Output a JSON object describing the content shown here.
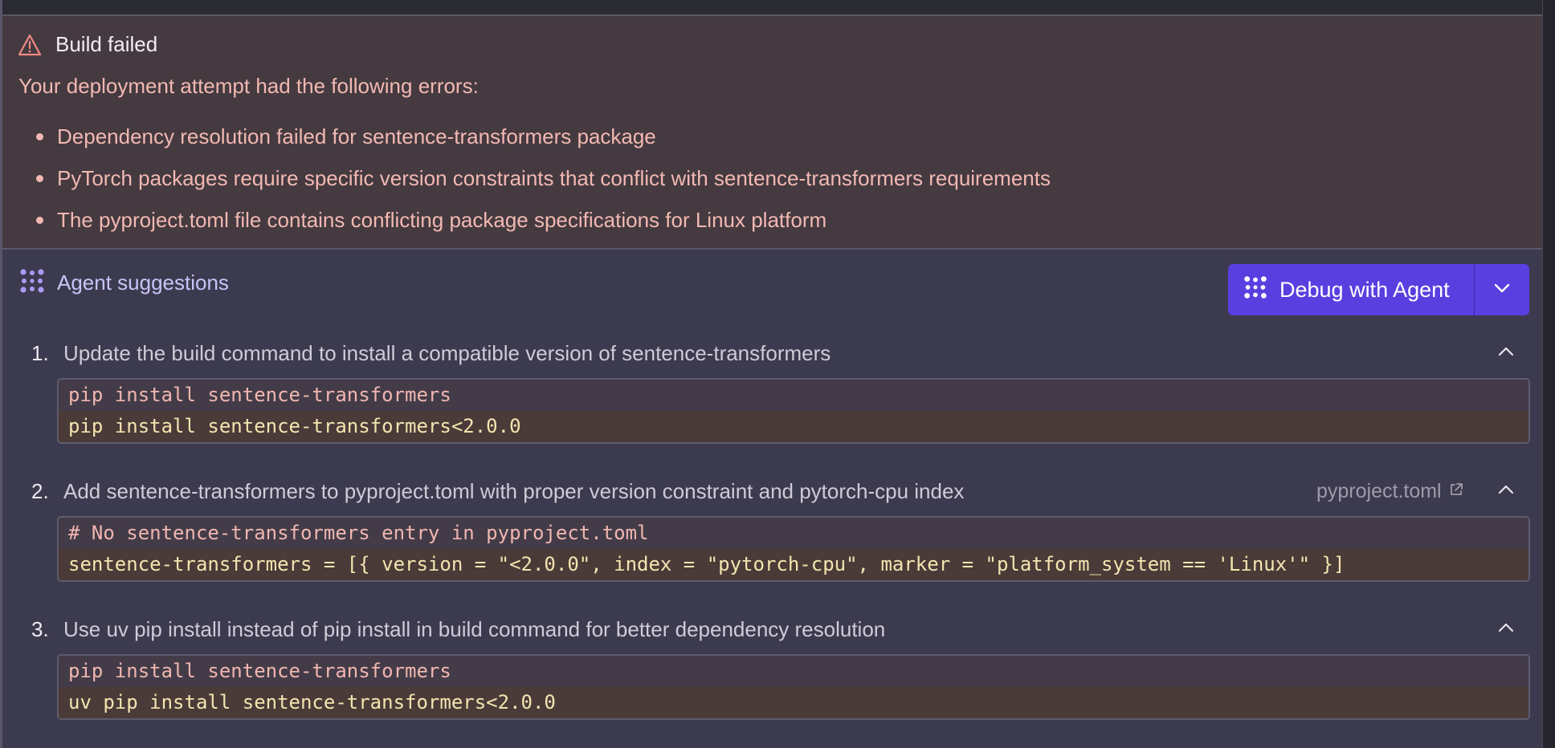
{
  "error": {
    "title": "Build failed",
    "intro": "Your deployment attempt had the following errors:",
    "items": [
      "Dependency resolution failed for sentence-transformers package",
      "PyTorch packages require specific version constraints that conflict with sentence-transformers requirements",
      "The pyproject.toml file contains conflicting package specifications for Linux platform"
    ],
    "icon": "warning-triangle-icon",
    "color": "#f3b8b2"
  },
  "suggestions": {
    "label": "Agent suggestions",
    "icon": "agent-icon",
    "debug_button": {
      "label": "Debug with Agent",
      "color": "#5a3fe0"
    },
    "steps": [
      {
        "number": "1.",
        "text": "Update the build command to install a compatible version of sentence-transformers",
        "file": "",
        "old": "pip install sentence-transformers",
        "new": "pip install sentence-transformers<2.0.0"
      },
      {
        "number": "2.",
        "text": "Add sentence-transformers to pyproject.toml with proper version constraint and pytorch-cpu index",
        "file": "pyproject.toml",
        "old": "# No sentence-transformers entry in pyproject.toml",
        "new": "sentence-transformers = [{ version = \"<2.0.0\", index = \"pytorch-cpu\", marker = \"platform_system == 'Linux'\" }]"
      },
      {
        "number": "3.",
        "text": "Use uv pip install instead of pip install in build command for better dependency resolution",
        "file": "",
        "old": "pip install sentence-transformers",
        "new": "uv pip install sentence-transformers<2.0.0"
      }
    ]
  }
}
